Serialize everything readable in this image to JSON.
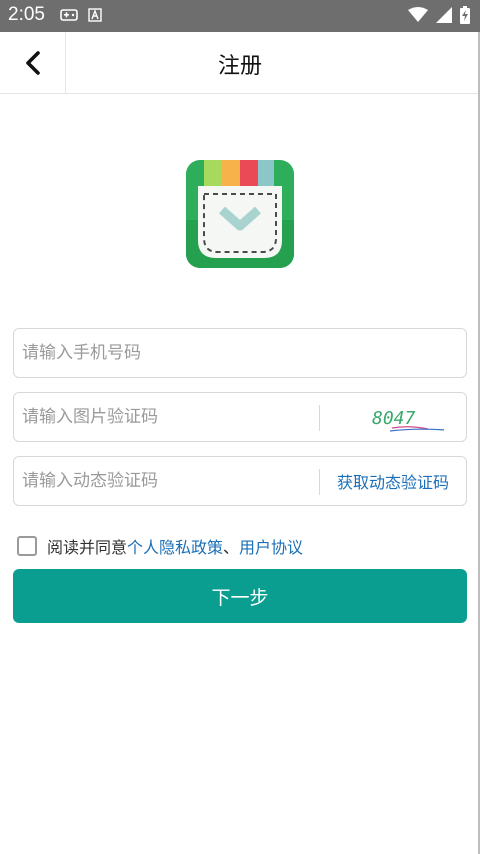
{
  "status_bar": {
    "time": "2:05",
    "left_icons": [
      "gamepad-icon",
      "text-a-icon"
    ],
    "right_icons": [
      "wifi-icon",
      "signal-icon",
      "battery-charging-icon"
    ]
  },
  "app_bar": {
    "title": "注册",
    "back_icon": "chevron-left-icon"
  },
  "form": {
    "phone": {
      "value": "",
      "placeholder": "请输入手机号码"
    },
    "image_captcha": {
      "value": "",
      "placeholder": "请输入图片验证码",
      "captcha_text": "8047"
    },
    "sms_code": {
      "value": "",
      "placeholder": "请输入动态验证码",
      "button_label": "获取动态验证码"
    }
  },
  "agreement": {
    "checked": false,
    "prefix": "阅读并同意",
    "privacy_link": "个人隐私政策",
    "separator": "、",
    "user_link": "用户协议"
  },
  "next_button": {
    "label": "下一步"
  },
  "colors": {
    "primary": "#0a9e91",
    "link": "#1b6fb8",
    "status_bar": "#6e6e6e"
  }
}
